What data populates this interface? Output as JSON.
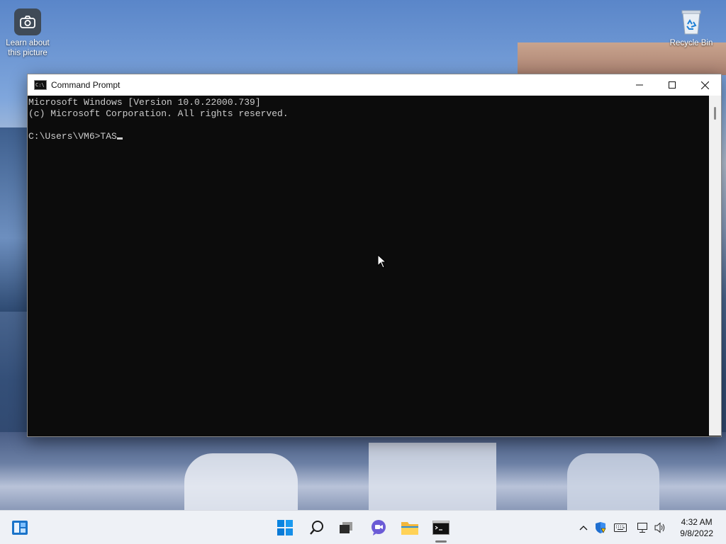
{
  "desktop": {
    "icons": [
      {
        "label": "Learn about this picture",
        "icon": "camera-icon"
      },
      {
        "label": "Recycle Bin",
        "icon": "recycle-bin-icon"
      }
    ]
  },
  "window": {
    "title": "Command Prompt",
    "icon": "cmd-icon",
    "console_lines": [
      "Microsoft Windows [Version 10.0.22000.739]",
      "(c) Microsoft Corporation. All rights reserved.",
      "",
      "C:\\Users\\VM6>TAS"
    ],
    "buttons": {
      "minimize": "minimize-icon",
      "maximize": "maximize-icon",
      "close": "close-icon"
    }
  },
  "taskbar": {
    "widgets_icon": "widgets-icon",
    "pinned": [
      "windows-start-icon",
      "search-icon",
      "task-view-icon",
      "chat-icon",
      "file-explorer-icon",
      "command-prompt-icon"
    ],
    "tray": [
      "chevron-up-icon",
      "security-shield-icon",
      "keyboard-icon",
      "network-icon",
      "volume-icon"
    ],
    "time": "4:32 AM",
    "date": "9/8/2022"
  },
  "colors": {
    "console_bg": "#0c0c0c",
    "console_text": "#cccccc",
    "accent": "#0078d4",
    "taskbar_bg": "#eef1f6"
  }
}
